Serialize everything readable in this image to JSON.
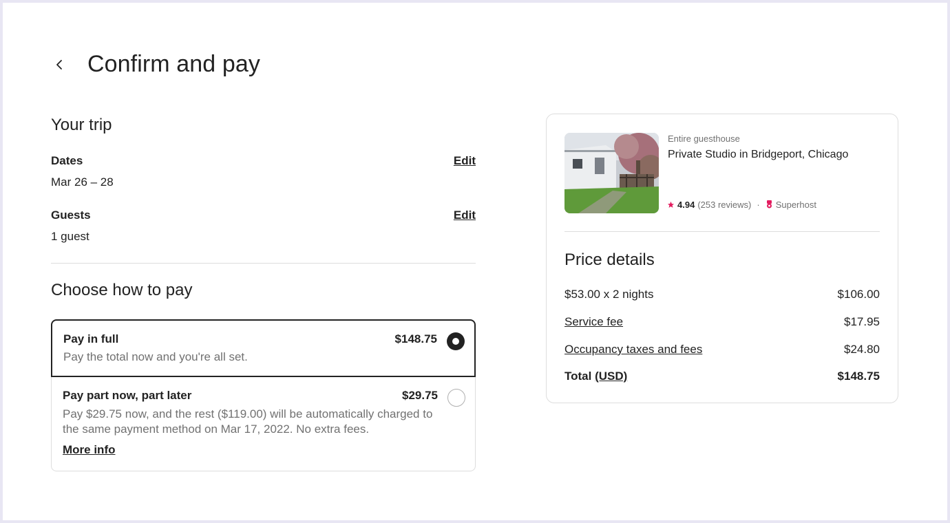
{
  "header": {
    "title": "Confirm and pay"
  },
  "trip": {
    "title": "Your trip",
    "dates_label": "Dates",
    "dates_value": "Mar 26 – 28",
    "dates_edit": "Edit",
    "guests_label": "Guests",
    "guests_value": "1 guest",
    "guests_edit": "Edit"
  },
  "payment": {
    "title": "Choose how to pay",
    "options": [
      {
        "name": "Pay in full",
        "price": "$148.75",
        "description": "Pay the total now and you're all set.",
        "selected": true
      },
      {
        "name": "Pay part now, part later",
        "price": "$29.75",
        "description": "Pay $29.75 now, and the rest ($119.00) will be automatically charged to the same payment method on Mar 17, 2022. No extra fees.",
        "link": "More info",
        "selected": false
      }
    ]
  },
  "listing": {
    "type": "Entire guesthouse",
    "name": "Private Studio in Bridgeport, Chicago",
    "rating": "4.94",
    "reviews": "(253 reviews)",
    "separator": "·",
    "superhost": "Superhost"
  },
  "price_details": {
    "title": "Price details",
    "rows": [
      {
        "label": "$53.00 x 2 nights",
        "value": "$106.00"
      },
      {
        "label": "Service fee",
        "value": "$17.95"
      },
      {
        "label": "Occupancy taxes and fees",
        "value": "$24.80"
      }
    ],
    "total_label": "Total",
    "total_currency": "(USD)",
    "total_value": "$148.75"
  },
  "colors": {
    "accent": "#222222",
    "star": "#e31c5f",
    "border": "#dddddd",
    "muted": "#717171"
  }
}
